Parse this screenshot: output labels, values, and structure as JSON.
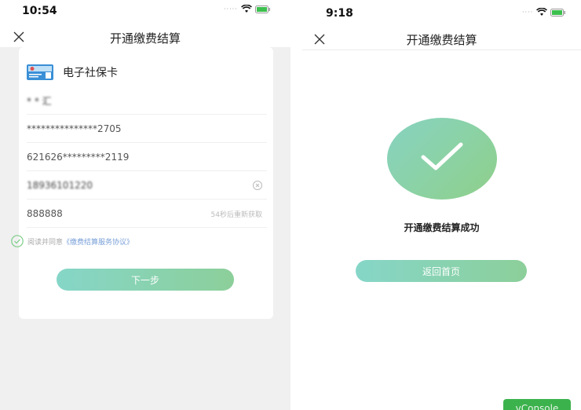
{
  "colors": {
    "accent_start": "#86d6c8",
    "accent_end": "#8ccf9a",
    "vconsole_green": "#3cb24d",
    "link_blue": "#7aa0d8"
  },
  "left_screen": {
    "status_time": "10:54",
    "nav_title": "开通缴费结算",
    "card_title": "电子社保卡",
    "name_value": "* * 汇",
    "id_value": "***************2705",
    "bank_card_value": "621626*********2119",
    "phone_value": "18936101220",
    "code_value": "888888",
    "code_button": "54秒后重新获取",
    "agree_prefix": "阅读并同意",
    "agree_link": "《缴费结算服务协议》",
    "next_button": "下一步"
  },
  "right_screen": {
    "status_time": "9:18",
    "nav_title": "开通缴费结算",
    "success_text": "开通缴费结算成功",
    "home_button": "返回首页",
    "vconsole_label": "vConsole"
  },
  "icons": [
    "close-icon",
    "wifi-icon",
    "battery-icon",
    "social-card-icon",
    "clear-icon",
    "check-circle-icon",
    "checkmark-icon"
  ]
}
